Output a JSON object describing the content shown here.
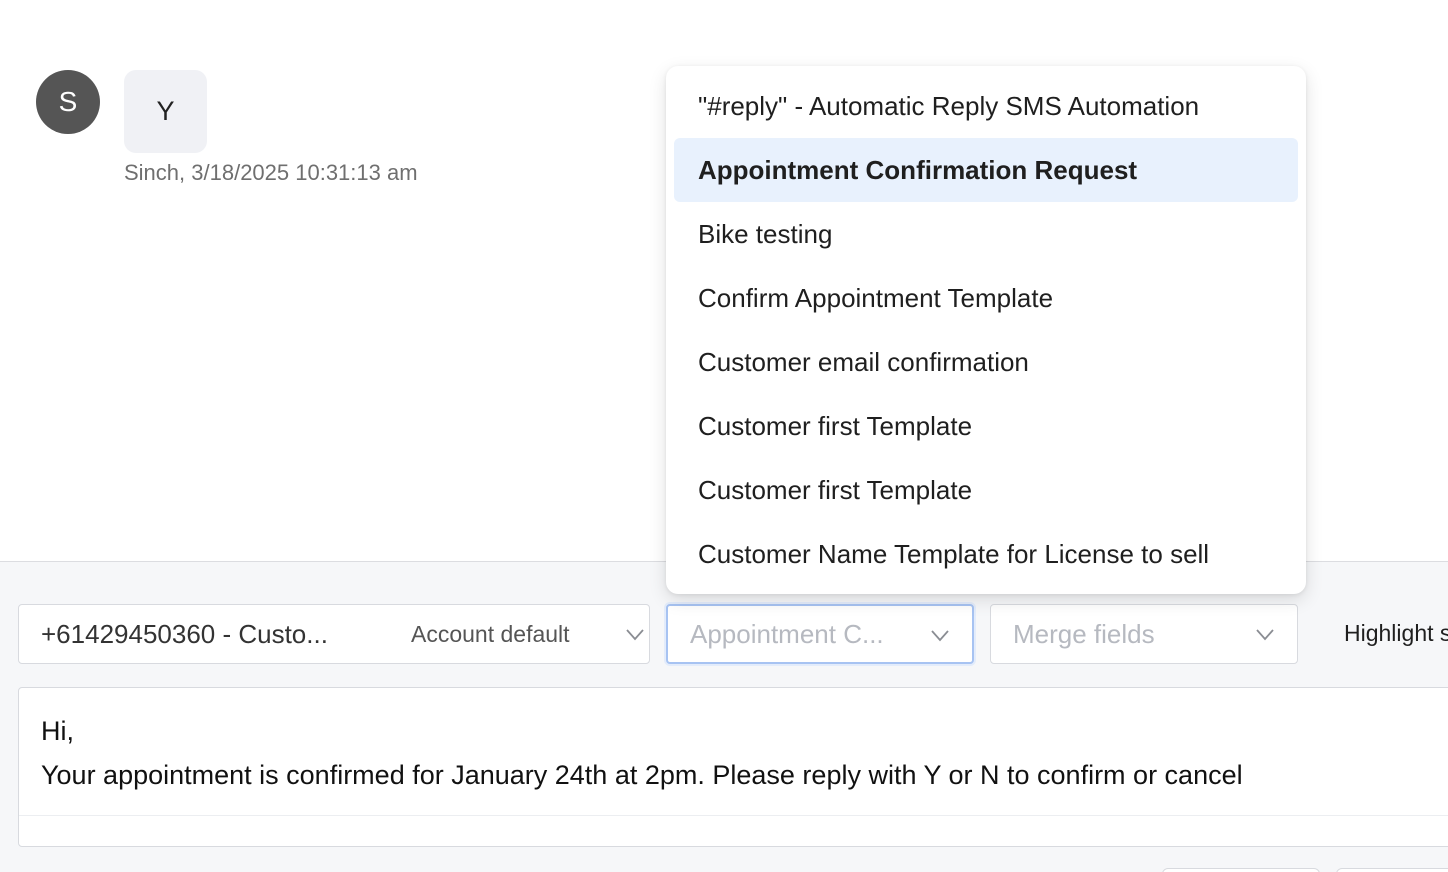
{
  "message": {
    "avatar_initial": "S",
    "bubble_text": "Y",
    "meta": "Sinch, 3/18/2025 10:31:13 am"
  },
  "composer": {
    "sender_number": "+61429450360 - Custo...",
    "sender_account": "Account default",
    "template_value": "Appointment C...",
    "merge_placeholder": "Merge fields",
    "highlight_label": "Highlight s",
    "message_lines": [
      "Hi,",
      "Your appointment is confirmed for January 24th at 2pm. Please reply with Y or N to confirm or cancel"
    ]
  },
  "template_dropdown": {
    "items": [
      "\"#reply\" - Automatic Reply SMS Automation",
      "Appointment Confirmation Request",
      "Bike testing",
      "Confirm Appointment Template",
      "Customer email confirmation",
      "Customer first Template",
      "Customer first Template",
      "Customer Name Template for License to sell"
    ],
    "active_index": 1
  },
  "icons": {
    "chevron": "chevron-down-icon"
  },
  "colors": {
    "avatar_bg": "#555555",
    "active_item_bg": "#e8f1fd",
    "focus_border": "#a7c3f2",
    "placeholder": "#b6b9c0"
  }
}
